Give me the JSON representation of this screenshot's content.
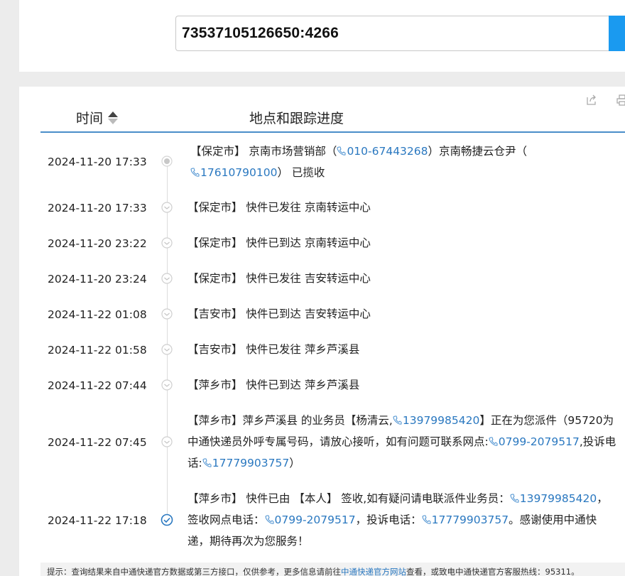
{
  "search": {
    "tracking_number": "73537105126650:4266"
  },
  "toolbar": {
    "share_icon": "share-icon",
    "print_icon": "print-icon"
  },
  "table": {
    "col_time": "时间",
    "col_progress": "地点和跟踪进度"
  },
  "events": [
    {
      "time": "2024-11-20 17:33",
      "status": "collected",
      "parts": [
        {
          "t": "【保定市】 京南市场营销部（"
        },
        {
          "p": "010-67443268"
        },
        {
          "t": "）京南畅捷云仓尹（"
        },
        {
          "p": "17610790100"
        },
        {
          "t": "） 已揽收"
        }
      ]
    },
    {
      "time": "2024-11-20 17:33",
      "status": "transit",
      "parts": [
        {
          "t": "【保定市】 快件已发往 京南转运中心"
        }
      ]
    },
    {
      "time": "2024-11-20 23:22",
      "status": "transit",
      "parts": [
        {
          "t": "【保定市】 快件已到达 京南转运中心"
        }
      ]
    },
    {
      "time": "2024-11-20 23:24",
      "status": "transit",
      "parts": [
        {
          "t": "【保定市】 快件已发往 吉安转运中心"
        }
      ]
    },
    {
      "time": "2024-11-22 01:08",
      "status": "transit",
      "parts": [
        {
          "t": "【吉安市】 快件已到达 吉安转运中心"
        }
      ]
    },
    {
      "time": "2024-11-22 01:58",
      "status": "transit",
      "parts": [
        {
          "t": "【吉安市】 快件已发往 萍乡芦溪县"
        }
      ]
    },
    {
      "time": "2024-11-22 07:44",
      "status": "transit",
      "parts": [
        {
          "t": "【萍乡市】 快件已到达 萍乡芦溪县"
        }
      ]
    },
    {
      "time": "2024-11-22 07:45",
      "status": "transit",
      "parts": [
        {
          "t": "【萍乡市】萍乡芦溪县 的业务员【杨清云,"
        },
        {
          "p": "13979985420"
        },
        {
          "t": "】正在为您派件（95720为中通快递员外呼专属号码，请放心接听，如有问题可联系网点:"
        },
        {
          "p": "0799-2079517"
        },
        {
          "t": ",投诉电话:"
        },
        {
          "p": "17779903757"
        },
        {
          "t": "）"
        }
      ]
    },
    {
      "time": "2024-11-22 17:18",
      "status": "delivered",
      "parts": [
        {
          "t": "【萍乡市】 快件已由 【本人】 签收,如有疑问请电联派件业务员："
        },
        {
          "p": "13979985420"
        },
        {
          "t": "，签收网点电话："
        },
        {
          "p": "0799-2079517"
        },
        {
          "t": "，投诉电话："
        },
        {
          "p": "17779903757"
        },
        {
          "t": "。感谢使用中通快递，期待再次为您服务！"
        }
      ]
    }
  ],
  "footer": {
    "tip_prefix": "提示：查询结果来自中通快递官方数据或第三方接口，仅供参考，更多信息请前往",
    "tip_link": "中通快递官方网站",
    "tip_suffix": "查看，或致电中通快递官方客服热线：95311。"
  },
  "colors": {
    "accent": "#1a9af0",
    "link": "#2a78c0",
    "header_line": "#4a8ec9",
    "timeline": "#dcdcdc"
  }
}
